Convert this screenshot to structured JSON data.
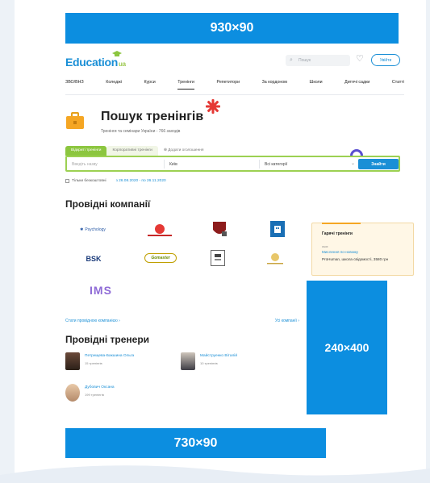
{
  "ads": {
    "top": "930×90",
    "side": "240×400",
    "bottom": "730×90"
  },
  "header": {
    "logo": "Education",
    "logo_suffix": "ua",
    "search_placeholder": "Пошук",
    "login": "Увійти"
  },
  "nav": [
    "ЗВО/ВНЗ",
    "Коледжі",
    "Курси",
    "Тренінги",
    "Репетитори",
    "За кордоном",
    "Школи",
    "Дитячі садки",
    "Статті"
  ],
  "hero": {
    "title": "Пошук тренінгів",
    "subtitle": "Тренінги та семінари України - 766 заходів"
  },
  "tabs": [
    "Відкриті тренінги",
    "Корпоративні тренінги",
    "Додати оголошення"
  ],
  "filters": {
    "name_placeholder": "Введіть назву",
    "city": "Київ",
    "category": "Всі категорії",
    "find": "Знайти"
  },
  "free_row": {
    "label": "Тільки безкоштовні",
    "date_range": "з 26.08.2020 - по 26.11.2020"
  },
  "companies": {
    "title": "Провідні компанії",
    "logos": [
      "Psychology",
      "Hello",
      "Seal",
      "Building",
      "BSK",
      "Gomaster",
      "Crest",
      "Golden",
      "IMS"
    ],
    "all_link": "Стати провідною компанією",
    "view_all": "Усі компанії"
  },
  "hot": {
    "title": "Гарячі тренінги",
    "date": "сьог.",
    "link": "Мислення по-новому",
    "desc": "ProHuman, школа свідомості, 3580 грн"
  },
  "trainers": {
    "title": "Провідні тренери",
    "items": [
      {
        "name": "Петрищева-Бакшина Ольга",
        "count": "15 тренінгів"
      },
      {
        "name": "Майструенко Віталій",
        "count": "10 тренінгів"
      },
      {
        "name": "Дубович Оксана",
        "count": "199 тренінгів"
      }
    ]
  },
  "colors": {
    "accent": "#1a8fd6",
    "ad_blue": "#0c8ee0",
    "green": "#8cc63f",
    "hot_bg": "#fff7e6"
  }
}
